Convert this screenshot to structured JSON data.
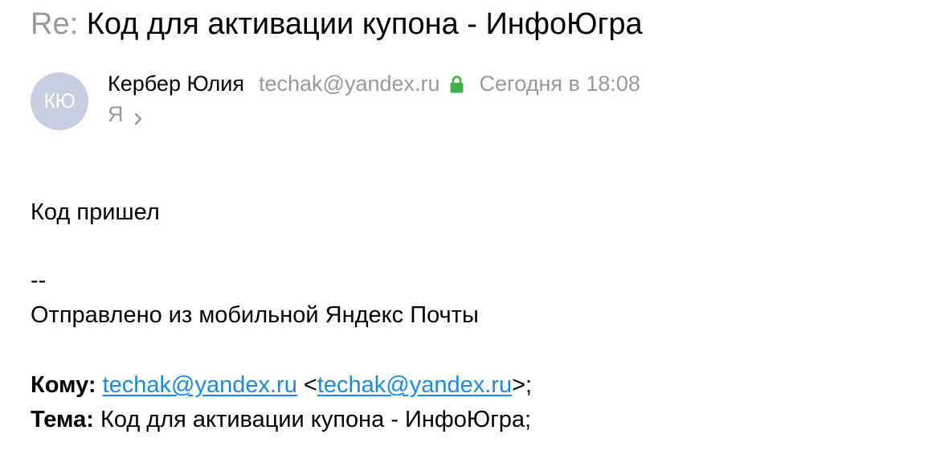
{
  "header": {
    "re_prefix": "Re:",
    "subject": " Код для активации купона - ИнфоЮгра"
  },
  "sender": {
    "avatar_initials": "КЮ",
    "name": "Кербер Юлия",
    "email": "techak@yandex.ru",
    "date": "Сегодня в 18:08",
    "recipient": "Я",
    "lock_icon": "lock-icon",
    "chevron_icon": "chevron-right-icon"
  },
  "message": {
    "line1": "Код пришел",
    "signature_separator": "--",
    "signature": "Отправлено из мобильной Яндекс Почты",
    "to_label": "Кому:",
    "to_email_1": "techak@yandex.ru",
    "to_bracket_open": "<",
    "to_email_2": "techak@yandex.ru",
    "to_bracket_close": ">;",
    "subject_label": "Тема:",
    "subject_value": "Код для активации купона - ИнфоЮгра;"
  },
  "colors": {
    "muted": "#999999",
    "avatar_bg": "#c6cedf",
    "lock_green": "#3cb34a",
    "link": "#1e88e5"
  }
}
